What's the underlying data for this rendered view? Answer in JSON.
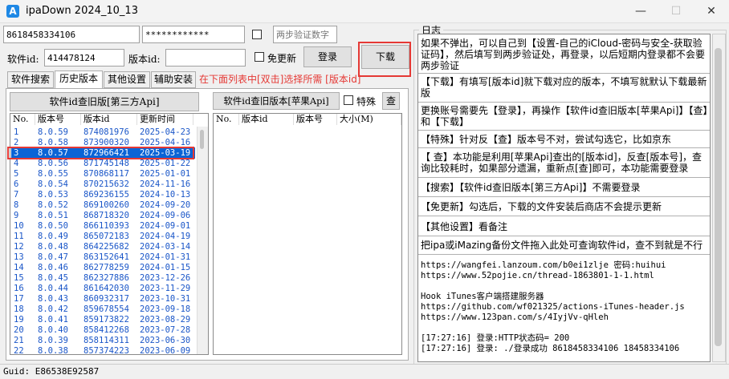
{
  "window": {
    "title": "ipaDown 2024_10_13",
    "minimize_glyph": "—",
    "maximize_glyph": "☐",
    "close_glyph": "✕",
    "app_icon_glyph": "A"
  },
  "account": {
    "apple_id": "8618458334106",
    "password": "************",
    "two_step_placeholder": "两步验证数字"
  },
  "ids": {
    "software_id_label": "软件id:",
    "software_id": "414478124",
    "version_id_label": "版本id:",
    "version_id": ""
  },
  "buttons": {
    "login": "登录",
    "download": "下载",
    "query_third_party": "软件id查旧版[第三方Api]",
    "query_apple": "软件id查旧版本[苹果Api]",
    "special": "特殊",
    "check": "查"
  },
  "no_update_label": "免更新",
  "tabs": [
    "软件搜索",
    "历史版本",
    "其他设置",
    "辅助安装"
  ],
  "hint": "在下面列表中[双击]选择所需 [版本id]",
  "left_table": {
    "columns": [
      "No.",
      "版本号",
      "版本id",
      "更新时间"
    ],
    "rows": [
      [
        "1",
        "8.0.59",
        "874081976",
        "2025-04-23"
      ],
      [
        "2",
        "8.0.58",
        "873900320",
        "2025-04-16"
      ],
      [
        "3",
        "8.0.57",
        "872966421",
        "2025-03-19"
      ],
      [
        "4",
        "8.0.56",
        "871745148",
        "2025-01-22"
      ],
      [
        "5",
        "8.0.55",
        "870868117",
        "2025-01-01"
      ],
      [
        "6",
        "8.0.54",
        "870215632",
        "2024-11-16"
      ],
      [
        "7",
        "8.0.53",
        "869236155",
        "2024-10-13"
      ],
      [
        "8",
        "8.0.52",
        "869100260",
        "2024-09-20"
      ],
      [
        "9",
        "8.0.51",
        "868718320",
        "2024-09-06"
      ],
      [
        "10",
        "8.0.50",
        "866110393",
        "2024-09-01"
      ],
      [
        "11",
        "8.0.49",
        "865072183",
        "2024-04-19"
      ],
      [
        "12",
        "8.0.48",
        "864225682",
        "2024-03-14"
      ],
      [
        "13",
        "8.0.47",
        "863152641",
        "2024-01-31"
      ],
      [
        "14",
        "8.0.46",
        "862778259",
        "2024-01-15"
      ],
      [
        "15",
        "8.0.45",
        "862327886",
        "2023-12-26"
      ],
      [
        "16",
        "8.0.44",
        "861642030",
        "2023-11-29"
      ],
      [
        "17",
        "8.0.43",
        "860932317",
        "2023-10-31"
      ],
      [
        "18",
        "8.0.42",
        "859678554",
        "2023-09-18"
      ],
      [
        "19",
        "8.0.41",
        "859173822",
        "2023-08-29"
      ],
      [
        "20",
        "8.0.40",
        "858412268",
        "2023-07-28"
      ],
      [
        "21",
        "8.0.39",
        "858114311",
        "2023-06-30"
      ],
      [
        "22",
        "8.0.38",
        "857374223",
        "2023-06-09"
      ]
    ],
    "selected_row_index": 2
  },
  "right_table": {
    "columns": [
      "No.",
      "版本id",
      "版本号",
      "大小(M)"
    ]
  },
  "log": {
    "title": "日志",
    "paragraphs": [
      "  如果不弹出，可以自己到【设置-自己的iCloud-密码与安全-获取验证码】，然后填写到两步验证处，再登录，以后短期内登录都不会要两步验证",
      "【下载】有填写[版本id]就下载对应的版本，不填写就默认下载最新版",
      "更换账号需要先【登录】，再操作【软件id查旧版本[苹果Api]】【查】和【下载】",
      "【特殊】针对反【查】版本号不对，尝试勾选它，比如京东",
      "【 查】本功能是利用[苹果Api]查出的[版本id]，反查[版本号]，查询比较耗时，如果部分遗漏，重新点[查]即可，本功能需要登录",
      "【搜索】【软件id查旧版本[第三方Api]】不需要登录",
      "【免更新】勾选后，下载的文件安装后商店不会提示更新",
      "【其他设置】看备注",
      "把ipa或iMazing备份文件拖入此处可查询软件id，查不到就是不行"
    ],
    "mono_block": "https://wangfei.lanzoum.com/b0ei1zlje 密码:huihui\nhttps://www.52pojie.cn/thread-1863801-1-1.html\n\nHook iTunes客户端搭建服务器\nhttps://github.com/wf021325/actions-iTunes-header.js\nhttps://www.123pan.com/s/4IyjVv-qHleh\n\n[17:27:16] 登录:HTTP状态码= 200\n[17:27:16] 登录: ./登录成功 8618458334106 18458334106"
  },
  "status": {
    "guid": "Guid: E86538E92587"
  },
  "colors": {
    "highlight": "#e53935",
    "selection": "#0a64d6",
    "link_text": "#1a56c8",
    "hint_text": "#e53935"
  }
}
